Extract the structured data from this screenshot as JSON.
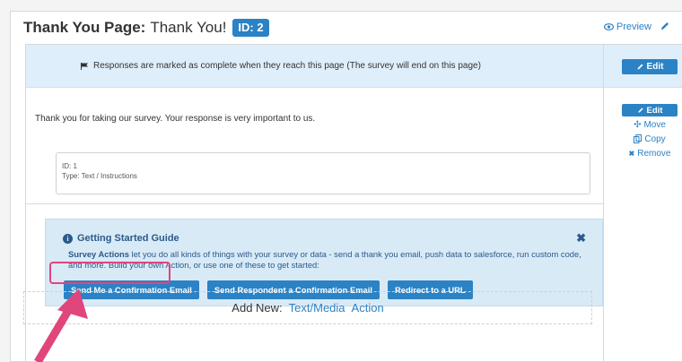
{
  "page": {
    "title_strong": "Thank You Page:",
    "title_rest": "Thank You!",
    "id_badge": "ID: 2",
    "preview_label": "Preview"
  },
  "completion": {
    "message": "Responses are marked as complete when they reach this page (The survey will end on this page)",
    "edit_label": "Edit"
  },
  "question": {
    "text": "Thank you for taking our survey. Your response is very important to us.",
    "meta_id": "ID: 1",
    "meta_type": "Type: Text / Instructions"
  },
  "side_actions": {
    "edit": "Edit",
    "move": "Move",
    "copy": "Copy",
    "remove": "Remove"
  },
  "guide": {
    "title": "Getting Started Guide",
    "body_bold": "Survey Actions",
    "body_rest": " let you do all kinds of things with your survey or data - send a thank you email, push data to salesforce, run custom code, and more. Build your own Action, or use one of these to get started:",
    "buttons": [
      "Send Me a Confirmation Email",
      "Send Respondent a Confirmation Email",
      "Redirect to a URL"
    ]
  },
  "add_new": {
    "label": "Add New:",
    "text_media": "Text/Media",
    "action": "Action"
  },
  "colors": {
    "accent": "#2b82c5",
    "guide_bg": "#d9eaf7",
    "completion_bg": "#dfeefb",
    "highlight": "#e0457b"
  },
  "icons": [
    "eye-icon",
    "pencil-icon",
    "flag-icon",
    "move-icon",
    "copy-icon",
    "remove-icon",
    "info-icon",
    "close-icon",
    "arrow-annotation"
  ]
}
